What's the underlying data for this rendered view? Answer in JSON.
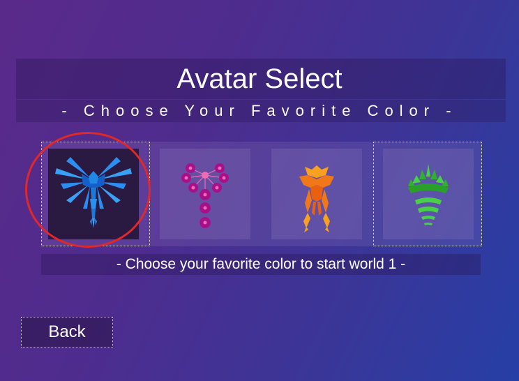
{
  "header": {
    "title": "Avatar Select",
    "subtitle": "- Choose Your Favorite Color -"
  },
  "avatars": [
    {
      "name": "blue",
      "color": "#1e7ad8",
      "icon": "blue-winged-avatar-icon",
      "selected": true
    },
    {
      "name": "magenta",
      "color": "#b0108c",
      "icon": "magenta-orb-avatar-icon",
      "selected": false
    },
    {
      "name": "orange",
      "color": "#f07818",
      "icon": "orange-flame-avatar-icon",
      "selected": false
    },
    {
      "name": "green",
      "color": "#38c038",
      "icon": "green-crown-avatar-icon",
      "selected": false
    }
  ],
  "info": {
    "message": "- Choose your favorite color to start world 1 -"
  },
  "footer": {
    "back_label": "Back"
  },
  "colors": {
    "highlight_ring": "#e02828"
  }
}
